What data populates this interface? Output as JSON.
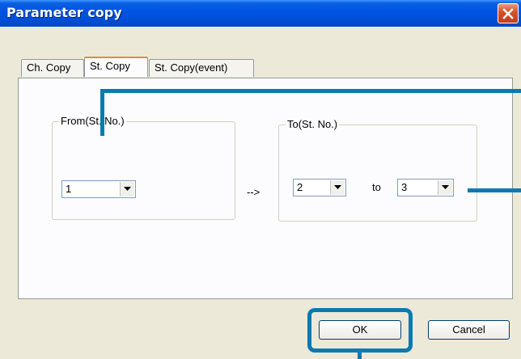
{
  "window": {
    "title": "Parameter copy"
  },
  "tabs": [
    {
      "label": "Ch. Copy",
      "active": false
    },
    {
      "label": "St. Copy",
      "active": true
    },
    {
      "label": "St. Copy(event)",
      "active": false
    }
  ],
  "from_group": {
    "legend": "From(St. No.)",
    "value": "1"
  },
  "arrow_text": "-->",
  "to_group": {
    "legend": "To(St. No.)",
    "start_value": "2",
    "to_label": "to",
    "end_value": "3"
  },
  "buttons": {
    "ok_label": "OK",
    "cancel_label": "Cancel"
  },
  "colors": {
    "callout": "#0a7ab1",
    "titlebar": "#0054e3",
    "close_button": "#d6542a"
  },
  "icons": {
    "close": "close-icon",
    "dropdown": "chevron-down-icon"
  }
}
